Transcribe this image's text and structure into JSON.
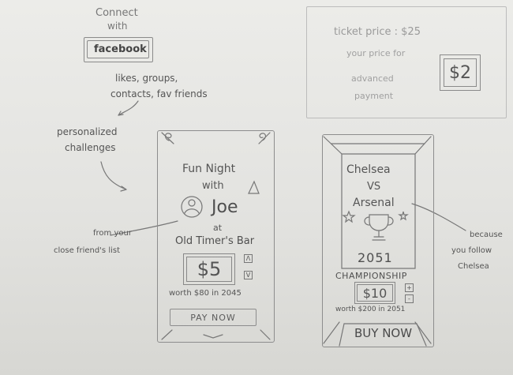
{
  "sketch": {
    "connect_line1": "Connect",
    "connect_line2": "with",
    "facebook_label": "facebook",
    "facebook_note_line1": "likes, groups,",
    "facebook_note_line2": "contacts, fav friends",
    "personalized_line1": "personalized",
    "personalized_line2": "challenges",
    "friends_note_line1": "from your",
    "friends_note_line2": "close friend's list",
    "follow_note_line1": "because",
    "follow_note_line2": "you follow",
    "follow_note_line3": "Chelsea",
    "ticket_price": "ticket price : $25",
    "your_price_line1": "your price for",
    "your_price_line2": "advanced",
    "your_price_line3": "payment",
    "advanced_price": "$2"
  },
  "phone_left": {
    "title_line1": "Fun Night",
    "title_line2": "with",
    "friend_name": "Joe",
    "at_label": "at",
    "venue": "Old Timer's Bar",
    "price": "$5",
    "up_icon": "Λ",
    "down_icon": "V",
    "worth_note": "worth $80 in 2045",
    "action_label": "PAY NOW"
  },
  "phone_right": {
    "team_home": "Chelsea",
    "vs_label": "VS",
    "team_away": "Arsenal",
    "year": "2051",
    "event_label": "CHAMPIONSHIP",
    "price": "$10",
    "plus_icon": "+",
    "minus_icon": "-",
    "worth_note": "worth $200 in 2051",
    "action_label": "BUY NOW"
  }
}
